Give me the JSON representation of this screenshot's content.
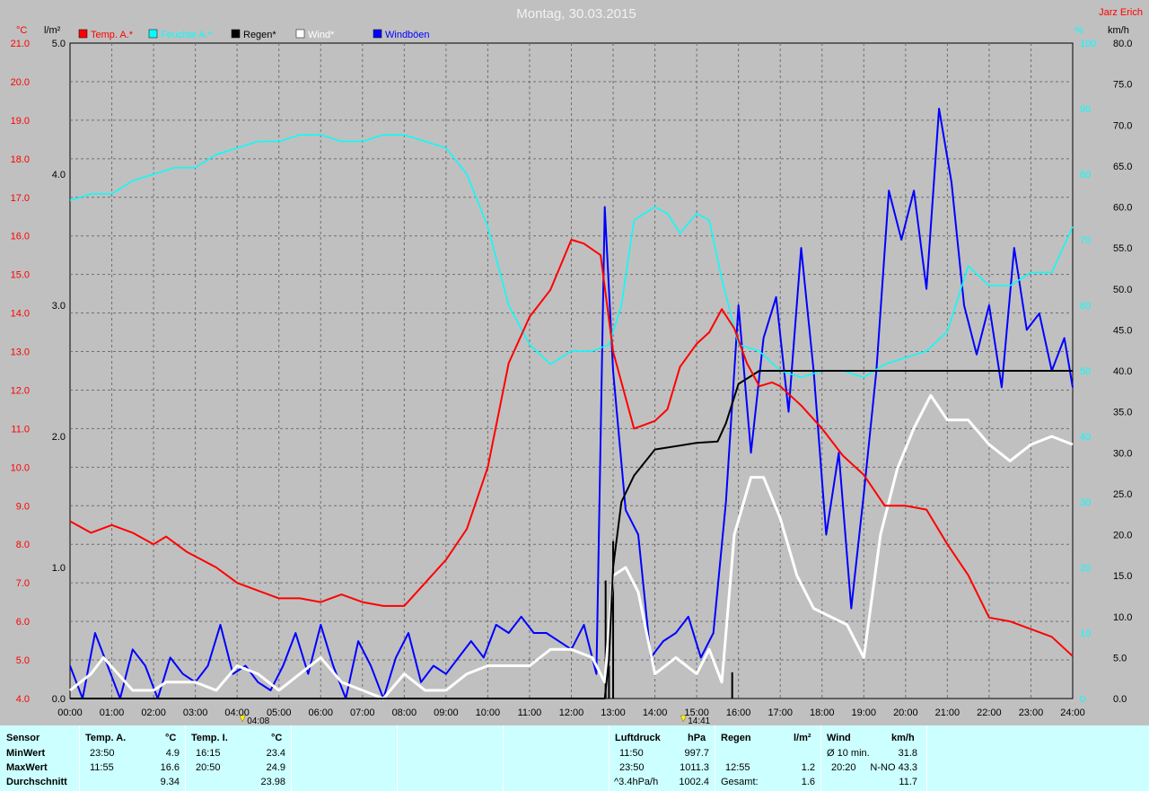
{
  "chart_data": {
    "type": "line",
    "title": "Montag, 30.03.2015",
    "author": "Jarz Erich",
    "axes": {
      "temp": {
        "unit": "°C",
        "ticks": [
          "21.0",
          "20.0",
          "19.0",
          "18.0",
          "17.0",
          "16.0",
          "15.0",
          "14.0",
          "13.0",
          "12.0",
          "11.0",
          "10.0",
          "9.0",
          "8.0",
          "7.0",
          "6.0",
          "5.0",
          "4.0"
        ],
        "ylim": [
          4,
          21
        ],
        "color": "#ff0000"
      },
      "rain": {
        "unit": "l/m²",
        "ticks": [
          "5.0",
          "4.0",
          "3.0",
          "2.0",
          "1.0",
          "0.0"
        ],
        "ylim": [
          0,
          5
        ],
        "color": "#000000"
      },
      "humidity": {
        "unit": "%",
        "ticks": [
          "100",
          "90",
          "80",
          "70",
          "60",
          "50",
          "40",
          "30",
          "20",
          "10",
          "0"
        ],
        "ylim": [
          0,
          100
        ],
        "color": "#00ffff"
      },
      "wind": {
        "unit": "km/h",
        "ticks": [
          "80.0",
          "75.0",
          "70.0",
          "65.0",
          "60.0",
          "55.0",
          "50.0",
          "45.0",
          "40.0",
          "35.0",
          "30.0",
          "25.0",
          "20.0",
          "15.0",
          "10.0",
          "5.0",
          "0.0"
        ],
        "ylim": [
          0,
          80
        ],
        "color": "#000000"
      }
    },
    "x_ticks": [
      "00:00",
      "01:00",
      "02:00",
      "03:00",
      "04:00",
      "05:00",
      "06:00",
      "07:00",
      "08:00",
      "09:00",
      "10:00",
      "11:00",
      "12:00",
      "13:00",
      "14:00",
      "15:00",
      "16:00",
      "17:00",
      "18:00",
      "19:00",
      "20:00",
      "21:00",
      "22:00",
      "23:00",
      "24:00"
    ],
    "markers": [
      {
        "time": 4.13,
        "label": "04:08"
      },
      {
        "time": 14.68,
        "label": "14:41"
      }
    ],
    "grid": true,
    "legend_position": "top-left",
    "series": [
      {
        "name": "Temp. A.*",
        "color": "#ff0000",
        "axis": "temp",
        "x": [
          0,
          0.5,
          1,
          1.5,
          2,
          2.3,
          2.8,
          3.5,
          4,
          4.5,
          5,
          5.5,
          6,
          6.5,
          7,
          7.5,
          8,
          8.5,
          9,
          9.5,
          10,
          10.5,
          11,
          11.5,
          12,
          12.3,
          12.7,
          13,
          13.5,
          14,
          14.3,
          14.6,
          15,
          15.3,
          15.6,
          15.9,
          16.2,
          16.5,
          16.8,
          17,
          17.5,
          18,
          18.5,
          19,
          19.5,
          20,
          20.5,
          21,
          21.5,
          22,
          22.5,
          23,
          23.5,
          24
        ],
        "y": [
          8.6,
          8.3,
          8.5,
          8.3,
          8.0,
          8.2,
          7.8,
          7.4,
          7.0,
          6.8,
          6.6,
          6.6,
          6.5,
          6.7,
          6.5,
          6.4,
          6.4,
          7.0,
          7.6,
          8.4,
          10.0,
          12.7,
          13.9,
          14.6,
          15.9,
          15.8,
          15.5,
          13.0,
          11.0,
          11.2,
          11.5,
          12.6,
          13.2,
          13.5,
          14.1,
          13.6,
          12.7,
          12.1,
          12.2,
          12.1,
          11.6,
          11.0,
          10.3,
          9.8,
          9.0,
          9.0,
          8.9,
          8.0,
          7.2,
          6.1,
          6.0,
          5.8,
          5.6,
          5.1
        ]
      },
      {
        "name": "Feuchte A.*",
        "color": "#00ffff",
        "axis": "humidity",
        "x": [
          0,
          0.5,
          1,
          1.5,
          2,
          2.5,
          3,
          3.5,
          4,
          4.5,
          5,
          5.5,
          6,
          6.5,
          7,
          7.5,
          8,
          8.5,
          9,
          9.5,
          10,
          10.5,
          11,
          11.5,
          12,
          12.5,
          12.9,
          13.2,
          13.5,
          14,
          14.3,
          14.6,
          15,
          15.3,
          15.6,
          16,
          16.5,
          17,
          17.5,
          18,
          18.5,
          19,
          19.5,
          20,
          20.5,
          21,
          21.5,
          22,
          22.5,
          23,
          23.5,
          24
        ],
        "y": [
          76,
          77,
          77,
          79,
          80,
          81,
          81,
          83,
          84,
          85,
          85,
          86,
          86,
          85,
          85,
          86,
          86,
          85,
          84,
          80,
          72,
          60,
          54,
          51,
          53,
          53,
          54,
          60,
          73,
          75,
          74,
          71,
          74,
          73,
          64,
          54,
          53,
          50,
          49,
          50,
          50,
          49,
          51,
          52,
          53,
          56,
          66,
          63,
          63,
          65,
          65,
          72
        ]
      },
      {
        "name": "Regen*",
        "color": "#000000",
        "axis": "rain",
        "x": [
          0,
          12.8,
          12.9,
          13.0,
          13.2,
          13.5,
          14.0,
          15.0,
          15.5,
          15.7,
          16.0,
          16.5,
          17.0,
          18.0,
          20.0,
          22.0,
          24.0
        ],
        "y": [
          0,
          0,
          0.3,
          1.0,
          1.5,
          1.7,
          1.9,
          1.95,
          1.96,
          2.1,
          2.4,
          2.5,
          2.5,
          2.5,
          2.5,
          2.5,
          2.5
        ]
      },
      {
        "name": "Wind*",
        "color": "#ffffff",
        "axis": "wind",
        "x": [
          0,
          0.5,
          0.8,
          1.5,
          2,
          2.3,
          3,
          3.5,
          4,
          4.5,
          5,
          5.5,
          6,
          6.5,
          7,
          7.5,
          8,
          8.5,
          9,
          9.5,
          10,
          10.5,
          11,
          11.5,
          12,
          12.5,
          12.8,
          13,
          13.3,
          13.6,
          14,
          14.5,
          15,
          15.3,
          15.6,
          15.9,
          16.3,
          16.6,
          17,
          17.4,
          17.8,
          18.2,
          18.6,
          19,
          19.4,
          19.8,
          20.2,
          20.6,
          21,
          21.5,
          22,
          22.5,
          23,
          23.5,
          24
        ],
        "y": [
          1,
          3,
          5,
          1,
          1,
          2,
          2,
          1,
          4,
          3,
          1,
          3,
          5,
          2,
          1,
          0,
          3,
          1,
          1,
          3,
          4,
          4,
          4,
          6,
          6,
          5,
          2,
          15,
          16,
          13,
          3,
          5,
          3,
          6,
          2,
          20,
          27,
          27,
          22,
          15,
          11,
          10,
          9,
          5,
          20,
          28,
          33,
          37,
          34,
          34,
          31,
          29,
          31,
          32,
          31
        ]
      },
      {
        "name": "Windböen",
        "color": "#0000ff",
        "axis": "wind",
        "x": [
          0,
          0.3,
          0.6,
          0.9,
          1.2,
          1.5,
          1.8,
          2.1,
          2.4,
          2.7,
          3,
          3.3,
          3.6,
          3.9,
          4.2,
          4.5,
          4.8,
          5.1,
          5.4,
          5.7,
          6,
          6.3,
          6.6,
          6.9,
          7.2,
          7.5,
          7.8,
          8.1,
          8.4,
          8.7,
          9,
          9.3,
          9.6,
          9.9,
          10.2,
          10.5,
          10.8,
          11.1,
          11.4,
          11.7,
          12,
          12.3,
          12.6,
          12.8,
          13.0,
          13.3,
          13.6,
          13.9,
          14.2,
          14.5,
          14.8,
          15.1,
          15.4,
          15.7,
          16.0,
          16.3,
          16.6,
          16.9,
          17.2,
          17.5,
          17.8,
          18.1,
          18.4,
          18.7,
          19.0,
          19.3,
          19.6,
          19.9,
          20.2,
          20.5,
          20.8,
          21.1,
          21.4,
          21.7,
          22.0,
          22.3,
          22.6,
          22.9,
          23.2,
          23.5,
          23.8,
          24
        ],
        "y": [
          4,
          0,
          8,
          4,
          0,
          6,
          4,
          0,
          5,
          3,
          2,
          4,
          9,
          3,
          4,
          2,
          1,
          4,
          8,
          3,
          9,
          4,
          0,
          7,
          4,
          0,
          5,
          8,
          2,
          4,
          3,
          5,
          7,
          5,
          9,
          8,
          10,
          8,
          8,
          7,
          6,
          9,
          3,
          60,
          40,
          23,
          20,
          5,
          7,
          8,
          10,
          5,
          8,
          24,
          48,
          30,
          44,
          49,
          35,
          55,
          40,
          20,
          30,
          11,
          25,
          40,
          62,
          56,
          62,
          50,
          72,
          63,
          48,
          42,
          48,
          38,
          55,
          45,
          47,
          40,
          44,
          38
        ]
      }
    ]
  },
  "stats": {
    "sensor_label": "Sensor",
    "row_labels": [
      "MinWert",
      "MaxWert",
      "Durchschnitt"
    ],
    "temp_a": {
      "header": "Temp. A.",
      "unit": "°C",
      "rows": [
        {
          "time": "23:50",
          "value": "4.9"
        },
        {
          "time": "11:55",
          "value": "16.6"
        },
        {
          "time": "",
          "value": "9.34"
        }
      ]
    },
    "temp_i": {
      "header": "Temp. I.",
      "unit": "°C",
      "rows": [
        {
          "time": "16:15",
          "value": "23.4"
        },
        {
          "time": "20:50",
          "value": "24.9"
        },
        {
          "time": "",
          "value": "23.98"
        }
      ]
    },
    "pressure": {
      "header": "Luftdruck",
      "unit": "hPa",
      "rows": [
        {
          "time": "11:50",
          "value": "997.7"
        },
        {
          "time": "23:50",
          "value": "1011.3"
        },
        {
          "time": "^3.4hPa/h",
          "value": "1002.4"
        }
      ]
    },
    "rain": {
      "header": "Regen",
      "unit": "l/m²",
      "rows": [
        {
          "time": "",
          "value": ""
        },
        {
          "time": "12:55",
          "value": "1.2"
        },
        {
          "time": "Gesamt:",
          "value": "1.6"
        }
      ]
    },
    "wind": {
      "header": "Wind",
      "unit": "km/h",
      "rows": [
        {
          "time": "Ø 10 min.",
          "value": "31.8"
        },
        {
          "time": "20:20",
          "value": "N-NO 43.3"
        },
        {
          "time": "",
          "value": "11.7"
        }
      ]
    }
  }
}
